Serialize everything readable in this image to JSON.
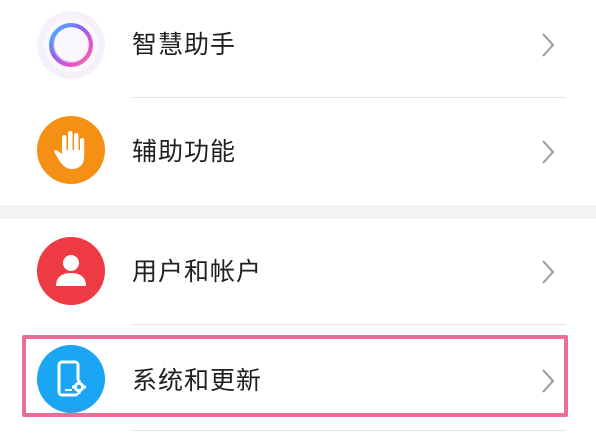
{
  "settings": {
    "groups": [
      {
        "items": [
          {
            "label": "智慧助手",
            "icon": "assistant-ring-icon",
            "color": "#f3eef9"
          },
          {
            "label": "辅助功能",
            "icon": "hand-icon",
            "color": "#f69015"
          }
        ]
      },
      {
        "items": [
          {
            "label": "用户和帐户",
            "icon": "user-icon",
            "color": "#ed3a43"
          },
          {
            "label": "系统和更新",
            "icon": "phone-gear-icon",
            "color": "#1aa6f2"
          }
        ]
      }
    ],
    "highlight_color": "#ec6d97"
  }
}
